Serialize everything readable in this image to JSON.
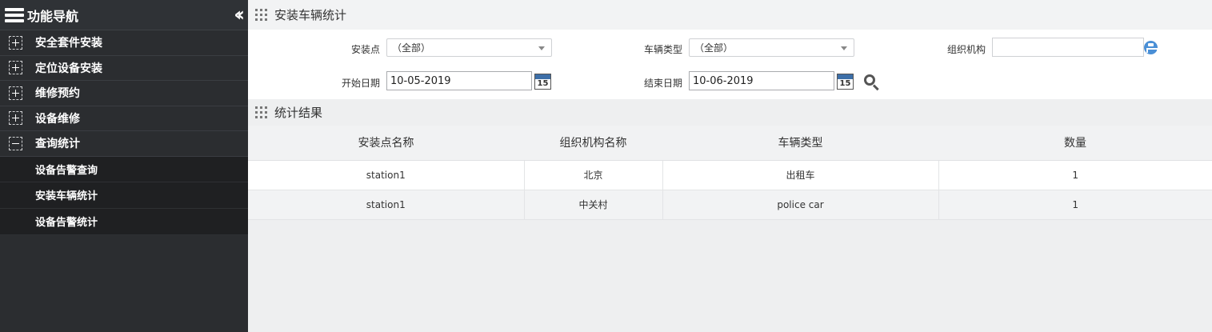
{
  "sidebar": {
    "title": "功能导航",
    "items": [
      {
        "label": "安全套件安装",
        "state": "collapsed"
      },
      {
        "label": "定位设备安装",
        "state": "collapsed"
      },
      {
        "label": "维修预约",
        "state": "collapsed"
      },
      {
        "label": "设备维修",
        "state": "collapsed"
      },
      {
        "label": "查询统计",
        "state": "expanded"
      }
    ],
    "subitems": [
      {
        "label": "设备告警查询"
      },
      {
        "label": "安装车辆统计"
      },
      {
        "label": "设备告警统计"
      }
    ]
  },
  "main": {
    "page_title": "安装车辆统计",
    "filters": {
      "install_point_label": "安装点",
      "install_point_value": "（全部）",
      "vehicle_type_label": "车辆类型",
      "vehicle_type_value": "（全部）",
      "org_label": "组织机构",
      "org_value": "",
      "start_date_label": "开始日期",
      "start_date_value": "10-05-2019",
      "end_date_label": "结束日期",
      "end_date_value": "10-06-2019",
      "calendar_day": "15"
    },
    "result_title": "统计结果",
    "table": {
      "headers": [
        "安装点名称",
        "组织机构名称",
        "车辆类型",
        "数量"
      ],
      "rows": [
        [
          "station1",
          "北京",
          "出租车",
          "1"
        ],
        [
          "station1",
          "中关村",
          "police car",
          "1"
        ]
      ]
    }
  },
  "icons": {
    "menu": "hamburger-icon",
    "collapse": "double-chevron-left-icon",
    "section": "grid-dots-icon",
    "calendar": "calendar-icon",
    "org": "org-tree-icon",
    "search": "search-icon"
  },
  "colors": {
    "sidebar_bg": "#2b2d30",
    "submenu_bg": "#1f2022",
    "main_bg": "#eeeff0",
    "accent": "#4a8fd6"
  }
}
